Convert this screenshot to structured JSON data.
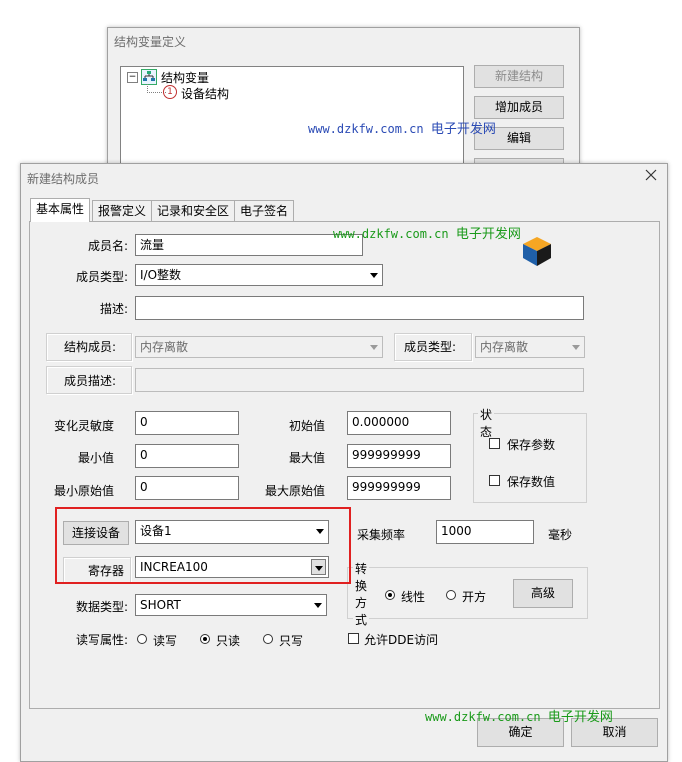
{
  "bg_window": {
    "title": "结构变量定义",
    "tree_root": "结构变量",
    "tree_child_index": "1",
    "tree_child": "设备结构",
    "btn_new_struct": "新建结构",
    "btn_add_member": "增加成员",
    "btn_edit": "编辑"
  },
  "watermarks": {
    "url": "www.dzkfw.com.cn",
    "name": "电子开发网"
  },
  "dialog": {
    "title": "新建结构成员",
    "tabs": [
      "基本属性",
      "报警定义",
      "记录和安全区",
      "电子签名"
    ],
    "member_name_label": "成员名:",
    "member_name_value": "流量",
    "member_type_label": "成员类型:",
    "member_type_value": "I/O整数",
    "desc_label": "描述:",
    "desc_value": "",
    "struct_member_label": "结构成员:",
    "struct_member_value": "内存离散",
    "struct_member_type_label": "成员类型:",
    "struct_member_type_value": "内存离散",
    "member_desc_label": "成员描述:",
    "member_desc_value": "",
    "sensitivity_label": "变化灵敏度",
    "sensitivity_value": "0",
    "init_label": "初始值",
    "init_value": "0.000000",
    "min_label": "最小值",
    "min_value": "0",
    "max_label": "最大值",
    "max_value": "999999999",
    "min_raw_label": "最小原始值",
    "min_raw_value": "0",
    "max_raw_label": "最大原始值",
    "max_raw_value": "999999999",
    "status_group": "状态",
    "keep_param": "保存参数",
    "keep_value": "保存数值",
    "connect_device_btn": "连接设备",
    "device_value": "设备1",
    "register_label": "寄存器",
    "register_value": "INCREA100",
    "sample_label": "采集频率",
    "sample_value": "1000",
    "sample_unit": "毫秒",
    "convert_group": "转换方式",
    "linear_label": "线性",
    "sqrt_label": "开方",
    "advanced_btn": "高级",
    "data_type_label": "数据类型:",
    "data_type_value": "SHORT",
    "rw_label": "读写属性:",
    "rw_read_write": "读写",
    "rw_read_only": "只读",
    "rw_write_only": "只写",
    "allow_dde": "允许DDE访问",
    "ok_btn": "确定",
    "cancel_btn": "取消"
  },
  "colors": {
    "highlight_box": "#e02020",
    "watermark_green": "#1a9a1a",
    "watermark_blue": "#2b4bb5"
  }
}
